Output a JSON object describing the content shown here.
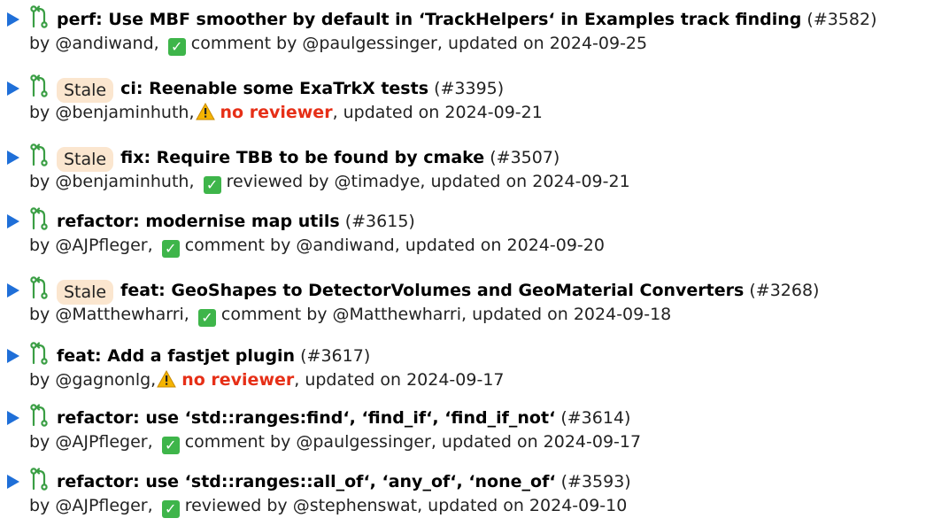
{
  "colors": {
    "triangle": "#1f6fd8",
    "pr_icon": "#3a9e44",
    "stale_bg": "#fbe6cf",
    "check_bg": "#3eb54a",
    "warning": "#f5b400",
    "no_reviewer": "#e62f17"
  },
  "icons": {
    "expand": "triangle-right-icon",
    "pr": "pull-request-icon",
    "approved": "check-mark-icon",
    "warning": "warning-icon"
  },
  "prs": [
    {
      "stale": "",
      "title": "perf: Use MBF smoother by default in ‘TrackHelpers‘ in Examples track finding",
      "number": "(#3582)",
      "author": "by @andiwand,",
      "status_type": "check",
      "status_text": "comment by @paulgessinger",
      "updated": ", updated on 2024-09-25"
    },
    {
      "stale": "Stale",
      "title": "ci: Reenable some ExaTrkX tests",
      "number": "(#3395)",
      "author": "by @benjaminhuth,",
      "status_type": "warning",
      "status_text": "no reviewer",
      "updated": ", updated on 2024-09-21"
    },
    {
      "stale": "Stale",
      "title": "fix: Require TBB to be found by cmake",
      "number": "(#3507)",
      "author": "by @benjaminhuth,",
      "status_type": "check",
      "status_text": "reviewed by @timadye",
      "updated": ", updated on 2024-09-21"
    },
    {
      "stale": "",
      "title": "refactor: modernise map utils",
      "number": "(#3615)",
      "author": "by @AJPfleger,",
      "status_type": "check",
      "status_text": "comment by @andiwand",
      "updated": ", updated on 2024-09-20"
    },
    {
      "stale": "Stale",
      "title": "feat: GeoShapes to DetectorVolumes and GeoMaterial Converters",
      "number": "(#3268)",
      "author": "by @Matthewharri,",
      "status_type": "check",
      "status_text": "comment by @Matthewharri",
      "updated": ", updated on 2024-09-18"
    },
    {
      "stale": "",
      "title": "feat: Add a fastjet plugin",
      "number": "(#3617)",
      "author": "by @gagnonlg,",
      "status_type": "warning",
      "status_text": "no reviewer",
      "updated": ", updated on 2024-09-17"
    },
    {
      "stale": "",
      "title": "refactor: use ‘std::ranges:find‘, ‘find_if‘, ‘find_if_not‘",
      "number": "(#3614)",
      "author": "by @AJPfleger,",
      "status_type": "check",
      "status_text": "comment by @paulgessinger",
      "updated": ", updated on 2024-09-17"
    },
    {
      "stale": "",
      "title": "refactor: use ‘std::ranges::all_of‘, ‘any_of‘, ‘none_of‘",
      "number": "(#3593)",
      "author": "by @AJPfleger,",
      "status_type": "check",
      "status_text": "reviewed by @stephenswat",
      "updated": ", updated on 2024-09-10"
    }
  ]
}
